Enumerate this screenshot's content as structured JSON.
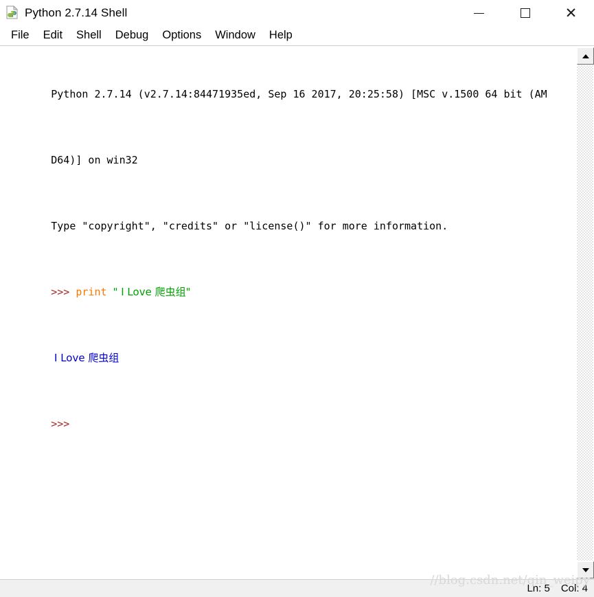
{
  "window": {
    "title": "Python 2.7.14 Shell",
    "icon": "python-file-icon"
  },
  "controls": {
    "minimize_label": "—",
    "maximize_label": "□",
    "close_label": "✕"
  },
  "menubar": {
    "items": [
      {
        "label": "File"
      },
      {
        "label": "Edit"
      },
      {
        "label": "Shell"
      },
      {
        "label": "Debug"
      },
      {
        "label": "Options"
      },
      {
        "label": "Window"
      },
      {
        "label": "Help"
      }
    ]
  },
  "console": {
    "banner_line1": "Python 2.7.14 (v2.7.14:84471935ed, Sep 16 2017, 20:25:58) [MSC v.1500 64 bit (AM",
    "banner_line2": "D64)] on win32",
    "banner_line3": "Type \"copyright\", \"credits\" or \"license()\" for more information.",
    "prompt": ">>>",
    "input_keyword": "print",
    "input_string": "\" I Love 爬虫组\"",
    "output_line": " I Love 爬虫组",
    "last_prompt": ">>>"
  },
  "scrollbar": {
    "up_arrow": "scroll-up-icon",
    "down_arrow": "scroll-down-icon"
  },
  "statusbar": {
    "line_label": "Ln: 5",
    "col_label": "Col: 4"
  },
  "watermark": {
    "text": "//blog.csdn.net/qin_weipy"
  },
  "colors": {
    "prompt": "#A52A2A",
    "keyword": "#FF7700",
    "string": "#00A000",
    "output": "#0000CC",
    "statusbar_bg": "#F0F0F0"
  }
}
